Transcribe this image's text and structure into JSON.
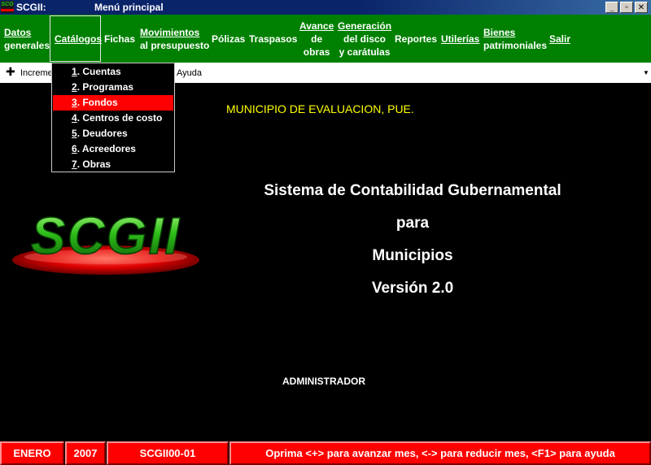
{
  "window": {
    "app_name": "SCGII:",
    "title": "Menú principal",
    "icon": "scgii-app-icon",
    "icon_text": "SCG"
  },
  "menu": {
    "items": [
      {
        "line1": "Datos",
        "line2": "generales"
      },
      {
        "line1": "Catálogos"
      },
      {
        "line1": "Fichas"
      },
      {
        "line1": "Movimientos",
        "line2": "al presupuesto"
      },
      {
        "line1": "Pólizas"
      },
      {
        "line1": "Traspasos"
      },
      {
        "line1": "Avance",
        "line2": "de",
        "line3": "obras"
      },
      {
        "line1": "Generación",
        "line2": "del disco",
        "line3": "y carátulas"
      },
      {
        "line1": "Reportes"
      },
      {
        "line1": "Utilerías"
      },
      {
        "line1": "Bienes",
        "line2": "patrimoniales"
      },
      {
        "line1": "Salir"
      }
    ],
    "active": "Catálogos"
  },
  "toolstrip": {
    "add_icon": "plus-icon",
    "text_left": "Increme",
    "text_right": "Ayuda"
  },
  "catalogos_dropdown": {
    "items": [
      {
        "num": "1",
        "label": ". Cuentas"
      },
      {
        "num": "2",
        "label": ". Programas"
      },
      {
        "num": "3",
        "label": ". Fondos"
      },
      {
        "num": "4",
        "label": ". Centros de costo"
      },
      {
        "num": "5",
        "label": ". Deudores"
      },
      {
        "num": "6",
        "label": ". Acreedores"
      },
      {
        "num": "7",
        "label": ". Obras"
      }
    ],
    "selected": ". Fondos"
  },
  "main": {
    "municipio": "MUNICIPIO DE EVALUACION, PUE.",
    "system_lines": [
      "Sistema de Contabilidad Gubernamental",
      "para",
      "Municipios",
      "Versión 2.0"
    ],
    "user": "ADMINISTRADOR",
    "logo_text": "SCGII"
  },
  "status": {
    "month": "ENERO",
    "year": "2007",
    "screen_code": "SCGII00-01",
    "hint": "Oprima <+> para avanzar mes, <-> para reducir mes, <F1> para ayuda"
  },
  "colors": {
    "menu_bg": "#008000",
    "selected_bg": "#ff0000",
    "title_bg": "#0a246a",
    "municipio_text": "#ffff00",
    "status_bg": "#ff0000"
  }
}
